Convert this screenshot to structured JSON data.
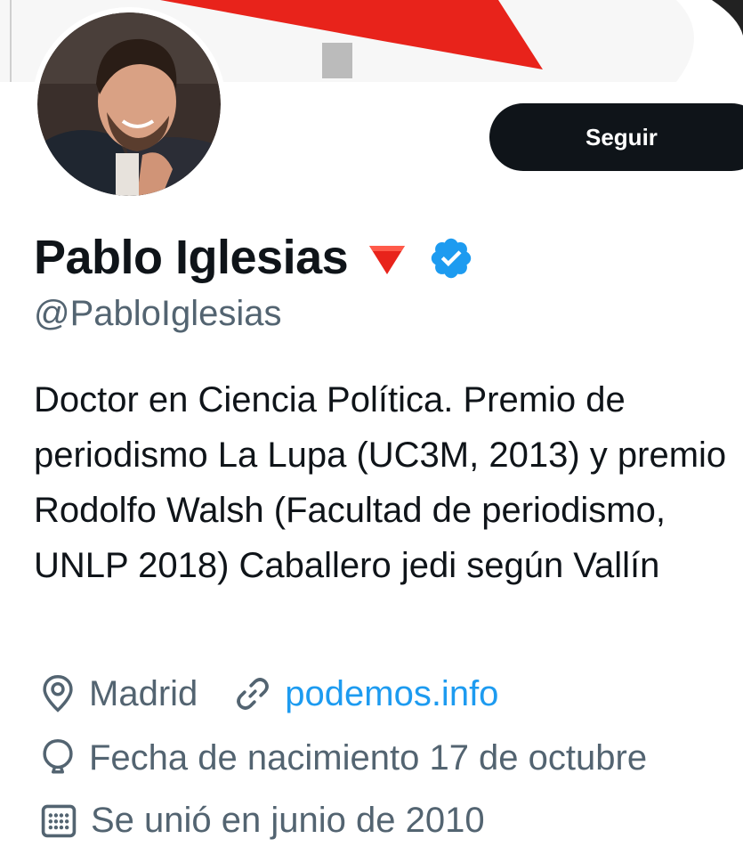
{
  "profile": {
    "follow_label": "Seguir",
    "name": "Pablo Iglesias",
    "handle": "@PabloIglesias",
    "bio": "Doctor en Ciencia Política. Premio de periodismo La Lupa (UC3M, 2013) y premio Rodolfo Walsh (Facultad de periodismo, UNLP 2018) Caballero jedi según Vallín",
    "location": "Madrid",
    "website": "podemos.info",
    "birthday": "Fecha de nacimiento 17 de octubre",
    "joined": "Se unió en junio de 2010"
  },
  "icons": {
    "name_emoji": "red-triangle-icon",
    "verified": "verified-badge-icon",
    "location": "location-pin-icon",
    "website": "link-icon",
    "birthday": "balloon-icon",
    "joined": "calendar-icon"
  },
  "colors": {
    "follow_button": "#0f1419",
    "link": "#1d9bf0",
    "verified": "#1d9bf0",
    "secondary_text": "#536471",
    "red_accent": "#e8231b"
  }
}
